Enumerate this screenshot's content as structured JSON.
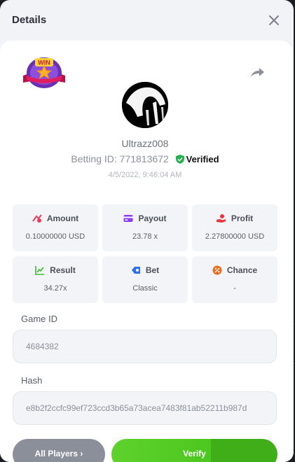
{
  "header": {
    "title": "Details",
    "close_icon": "close-icon"
  },
  "badge": {
    "text": "WIN",
    "icon": "trophy-star-badge"
  },
  "share_icon": "share-arrow-icon",
  "player": {
    "username": "Ultrazz008",
    "betting_id_label": "Betting ID:",
    "betting_id": "771813672",
    "verified_label": "Verified"
  },
  "timestamp": "4/5/2022, 9:46:04 AM",
  "stats": [
    {
      "label": "Amount",
      "value": "0.10000000 USD",
      "icon": "amount-icon",
      "color": "#ef3c5b"
    },
    {
      "label": "Payout",
      "value": "23.78 x",
      "icon": "payout-card-icon",
      "color": "#8b3cf0"
    },
    {
      "label": "Profit",
      "value": "2.27800000 USD",
      "icon": "profit-hand-icon",
      "color": "#e8363f"
    },
    {
      "label": "Result",
      "value": "34.27x",
      "icon": "result-chart-icon",
      "color": "#3dbb2e"
    },
    {
      "label": "Bet",
      "value": "Classic",
      "icon": "bet-tag-icon",
      "color": "#2f6ff0"
    },
    {
      "label": "Chance",
      "value": "-",
      "icon": "chance-percent-icon",
      "color": "#ef6a1c"
    }
  ],
  "game_id": {
    "label": "Game ID",
    "value": "4684382"
  },
  "hash": {
    "label": "Hash",
    "value": "e8b2f2ccfc99ef723ccd3b65a73acea7483f81ab52211b987d"
  },
  "buttons": {
    "all_players": "All Players ›",
    "verify": "Verify"
  },
  "colors": {
    "accent_green": "#4cc71f",
    "verified_green": "#22b14c"
  }
}
